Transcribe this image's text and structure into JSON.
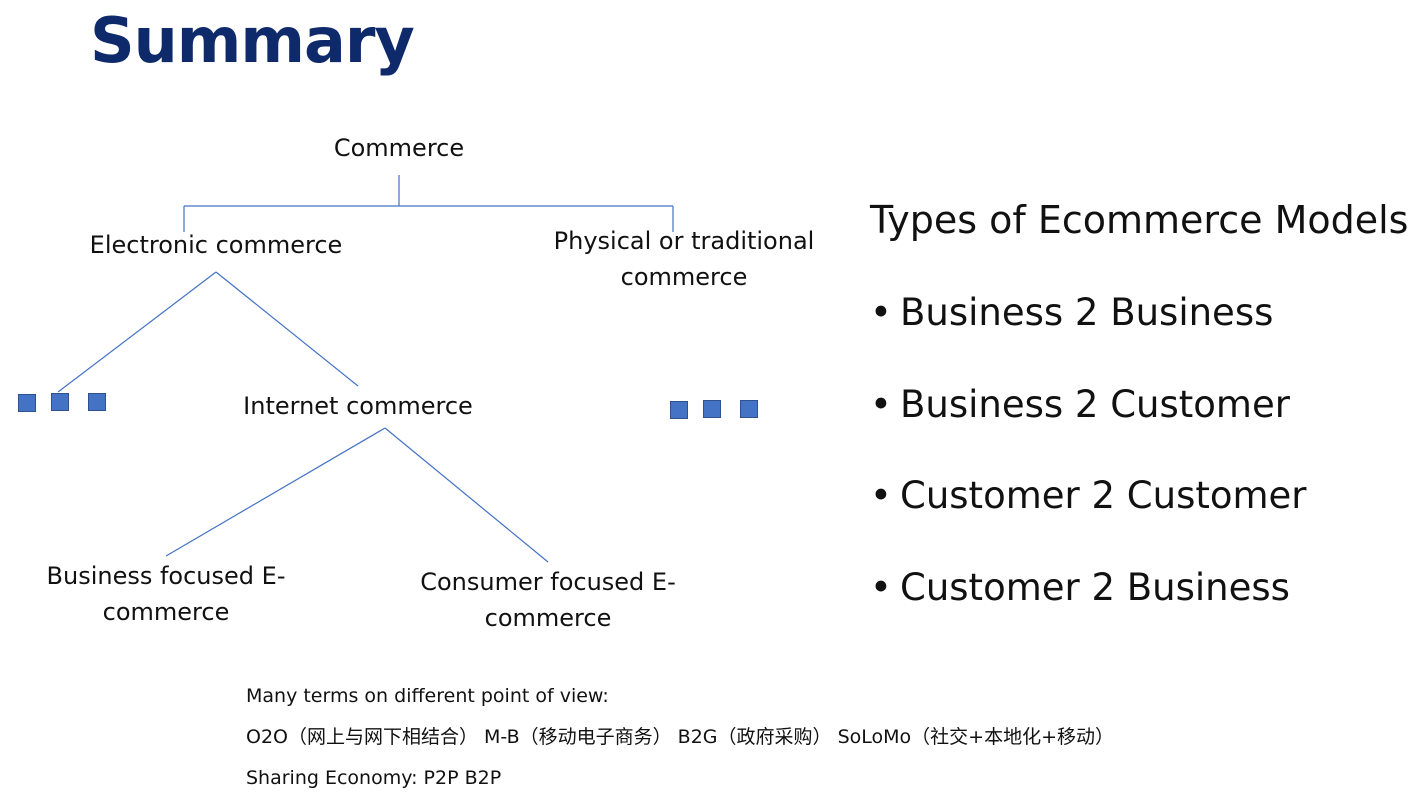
{
  "slide": {
    "title": "Summary"
  },
  "tree": {
    "root": "Commerce",
    "electronic": "Electronic commerce",
    "physical_line1": "Physical or traditional",
    "physical_line2": "commerce",
    "internet": "Internet commerce",
    "business_line1": "Business focused E-",
    "business_line2": "commerce",
    "consumer_line1": "Consumer focused E-",
    "consumer_line2": "commerce",
    "line_color": "#4472c4",
    "marker_color": "#4472c4"
  },
  "types": {
    "title": "Types of Ecommerce Models",
    "bullet": "•",
    "items": [
      "Business 2 Business",
      "Business 2 Customer",
      "Customer 2 Customer",
      "Customer 2 Business"
    ]
  },
  "notes": {
    "line1": "Many terms on different point of view:",
    "line2": "O2O（网上与网下相结合） M-B（移动电子商务） B2G（政府采购） SoLoMo（社交+本地化+移动）",
    "line3": "Sharing Economy: P2P  B2P"
  }
}
